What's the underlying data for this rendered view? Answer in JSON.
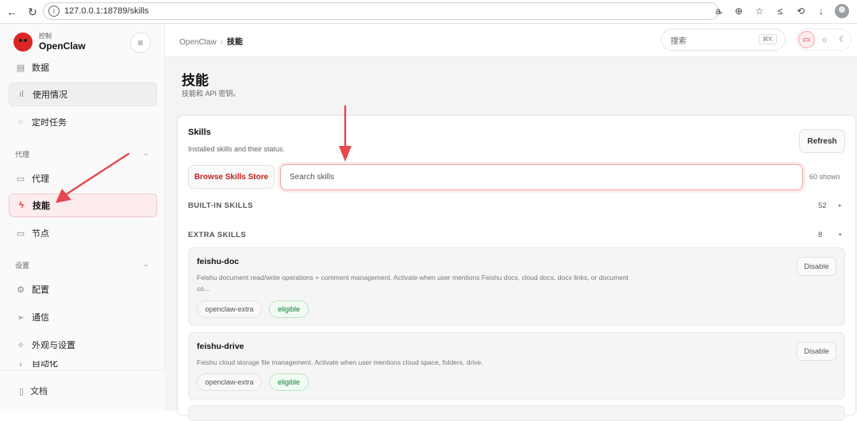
{
  "browser": {
    "url": "127.0.0.1:18789/skills"
  },
  "sidebar": {
    "brand_sub": "控制",
    "brand_name": "OpenClaw",
    "items_top": [
      {
        "label": "数据",
        "icon": "chat-icon"
      },
      {
        "label": "使用情况",
        "icon": "bar-chart-icon"
      },
      {
        "label": "定时任务",
        "icon": "loader-icon"
      }
    ],
    "section_agent": "代理",
    "items_agent": [
      {
        "label": "代理",
        "icon": "folder-icon"
      },
      {
        "label": "技能",
        "icon": "zap-icon"
      },
      {
        "label": "节点",
        "icon": "monitor-icon"
      }
    ],
    "section_settings": "设置",
    "items_settings": [
      {
        "label": "配置",
        "icon": "gear-icon"
      },
      {
        "label": "通信",
        "icon": "send-icon"
      },
      {
        "label": "外观与设置",
        "icon": "sparkle-icon"
      },
      {
        "label": "自动化",
        "icon": "chevron-icon"
      }
    ],
    "docs_label": "文档"
  },
  "topbar": {
    "crumb_root": "OpenClaw",
    "crumb_current": "技能",
    "search_placeholder": "搜索",
    "search_shortcut": "⌘K"
  },
  "page": {
    "title": "技能",
    "subtitle": "技能和 API 密钥。"
  },
  "skills_card": {
    "title": "Skills",
    "subtitle": "Installed skills and their status.",
    "refresh_label": "Refresh",
    "store_label": "Browse Skills Store",
    "search_placeholder": "Search skills",
    "shown_text": "60 shown",
    "builtin_label": "BUILT-IN SKILLS",
    "builtin_count": "52",
    "extra_label": "EXTRA SKILLS",
    "extra_count": "8",
    "skills": [
      {
        "name": "feishu-doc",
        "description": "Feishu document read/write operations + comment management. Activate when user mentions Feishu docs, cloud docs, docx links, or document co...",
        "source": "openclaw-extra",
        "status": "eligible",
        "action": "Disable"
      },
      {
        "name": "feishu-drive",
        "description": "Feishu cloud storage file management. Activate when user mentions cloud space, folders, drive.",
        "source": "openclaw-extra",
        "status": "eligible",
        "action": "Disable"
      }
    ]
  },
  "colors": {
    "accent": "#dc2626",
    "annotation_arrow": "#e5484d",
    "eligible_green": "#15803d"
  }
}
